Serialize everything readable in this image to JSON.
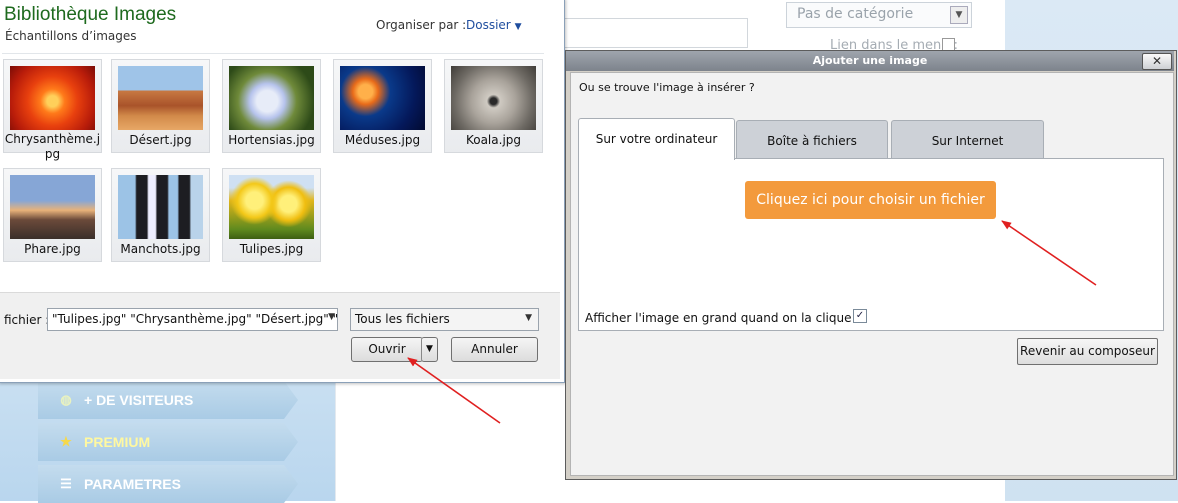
{
  "background_page": {
    "category_select": {
      "value": "Pas de catégorie"
    },
    "menu_link_label": "Lien dans le menu :",
    "nav_items": [
      {
        "label": "+ DE VISITEURS",
        "icon": "globe-icon"
      },
      {
        "label": "PREMIUM",
        "icon": "star-icon"
      },
      {
        "label": "PARAMETRES",
        "icon": "list-icon"
      }
    ]
  },
  "file_dialog": {
    "title": "Bibliothèque Images",
    "subtitle": "Échantillons d’images",
    "organize_label": "Organiser par :",
    "organize_value": "Dossier",
    "files": [
      {
        "name": "Chrysanthème.jpg"
      },
      {
        "name": "Désert.jpg"
      },
      {
        "name": "Hortensias.jpg"
      },
      {
        "name": "Méduses.jpg"
      },
      {
        "name": "Koala.jpg"
      },
      {
        "name": "Phare.jpg"
      },
      {
        "name": "Manchots.jpg"
      },
      {
        "name": "Tulipes.jpg"
      }
    ],
    "filename_label": "fichier :",
    "filename_value": "\"Tulipes.jpg\" \"Chrysanthème.jpg\" \"Désert.jpg\" \"Ho",
    "filetype_value": "Tous les fichiers",
    "open_button": "Ouvrir",
    "cancel_button": "Annuler"
  },
  "insert_dialog": {
    "title": "Ajouter une image",
    "close_glyph": "✕",
    "question": "Ou se trouve l'image à insérer ?",
    "tabs": [
      {
        "label": "Sur votre ordinateur",
        "active": true
      },
      {
        "label": "Boîte à fichiers",
        "active": false
      },
      {
        "label": "Sur Internet",
        "active": false
      }
    ],
    "choose_button": "Cliquez ici pour choisir un fichier",
    "enlarge_label": "Afficher l'image en grand quand on la clique :",
    "enlarge_checked": true,
    "back_button": "Revenir au composeur"
  },
  "colors": {
    "accent_orange": "#f39a3c",
    "title_green": "#1e6a1e",
    "annotation_red": "#e02020"
  }
}
